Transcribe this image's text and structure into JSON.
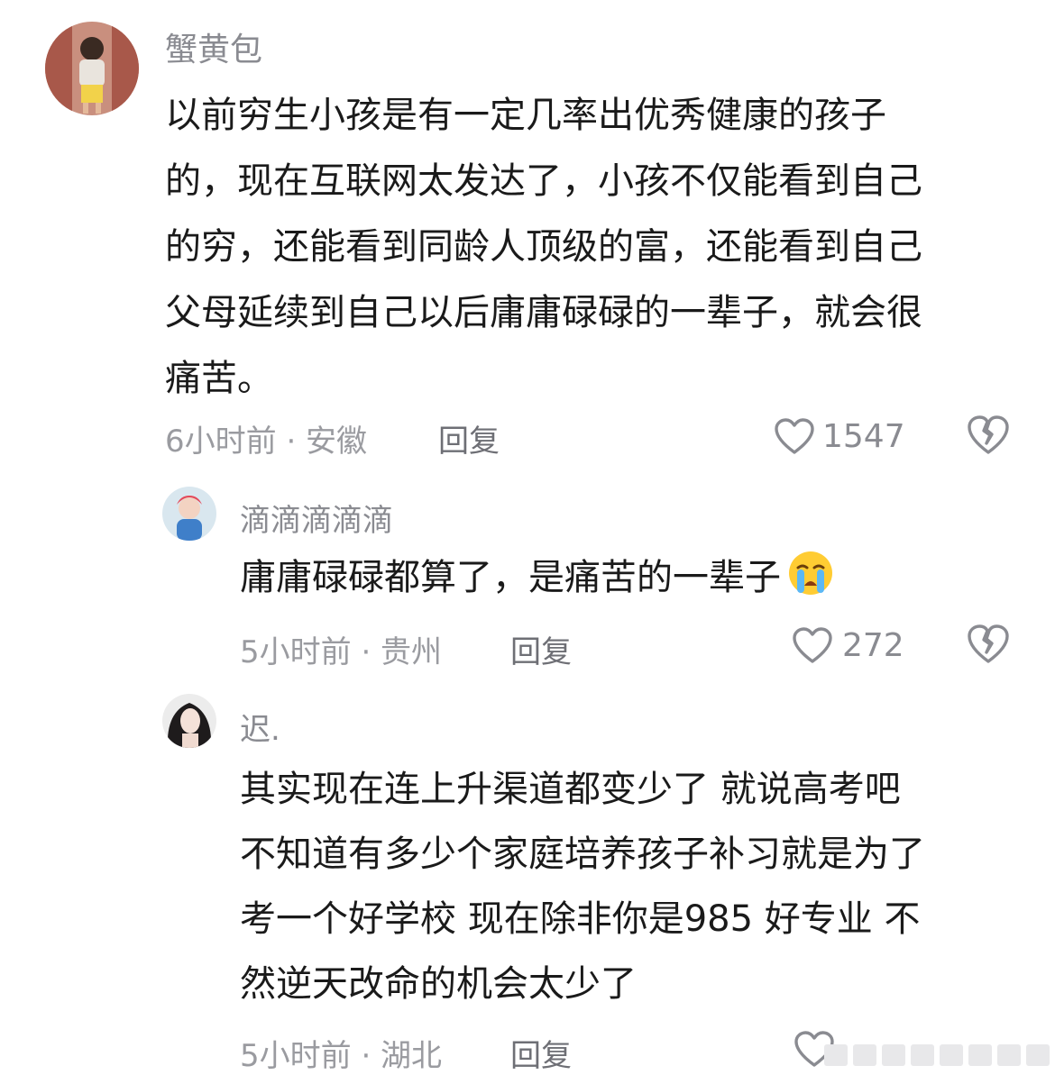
{
  "comments": [
    {
      "username": "蟹黄包",
      "lines": [
        "以前穷生小孩是有一定几率出优秀健康的孩子",
        "的，现在互联网太发达了，小孩不仅能看到自己",
        "的穷，还能看到同龄人顶级的富，还能看到自己",
        "父母延续到自己以后庸庸碌碌的一辈子，就会很",
        "痛苦。"
      ],
      "meta": "6小时前 · 安徽",
      "reply_label": "回复",
      "likes": "1547"
    },
    {
      "username": "滴滴滴滴滴",
      "lines": [
        "庸庸碌碌都算了，是痛苦的一辈子"
      ],
      "emoji": "crying-face",
      "meta": "5小时前 · 贵州",
      "reply_label": "回复",
      "likes": "272"
    },
    {
      "username": "迟.",
      "lines": [
        "其实现在连上升渠道都变少了 就说高考吧",
        "不知道有多少个家庭培养孩子补习就是为了",
        "考一个好学校 现在除非你是985 好专业 不",
        "然逆天改命的机会太少了"
      ],
      "meta": "5小时前 · 湖北",
      "reply_label": "回复"
    }
  ],
  "icons": {
    "like": "heart-outline-icon",
    "dislike": "broken-heart-icon"
  },
  "colors": {
    "text": "#1a1a1a",
    "muted": "#9a9ba0"
  }
}
